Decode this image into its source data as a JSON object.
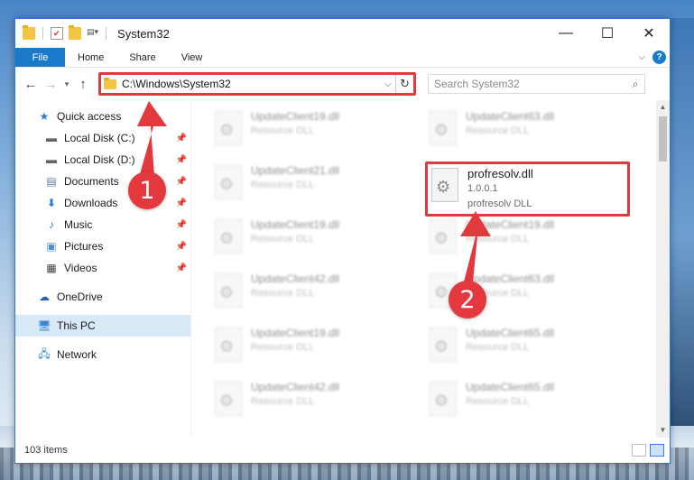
{
  "window": {
    "title": "System32",
    "controls": {
      "minimize": "—",
      "maximize": "☐",
      "close": "✕"
    }
  },
  "ribbon": {
    "tabs": [
      {
        "label": "File"
      },
      {
        "label": "Home"
      },
      {
        "label": "Share"
      },
      {
        "label": "View"
      }
    ],
    "help": "?"
  },
  "addressbar": {
    "path": "C:\\Windows\\System32",
    "search_placeholder": "Search System32"
  },
  "navpane": {
    "items": [
      {
        "label": "Quick access",
        "icon": "star-icon"
      },
      {
        "label": "Local Disk (C:)",
        "icon": "drive-icon",
        "pinned": true
      },
      {
        "label": "Local Disk (D:)",
        "icon": "drive-icon",
        "pinned": true
      },
      {
        "label": "Documents",
        "icon": "documents-icon",
        "pinned": true
      },
      {
        "label": "Downloads",
        "icon": "download-icon",
        "pinned": true
      },
      {
        "label": "Music",
        "icon": "music-icon",
        "pinned": true
      },
      {
        "label": "Pictures",
        "icon": "pictures-icon",
        "pinned": true
      },
      {
        "label": "Videos",
        "icon": "videos-icon",
        "pinned": true
      },
      {
        "label": "OneDrive",
        "icon": "cloud-icon"
      },
      {
        "label": "This PC",
        "icon": "computer-icon",
        "selected": true
      },
      {
        "label": "Network",
        "icon": "network-icon"
      }
    ]
  },
  "files": {
    "left_column": [
      {
        "name": "UpdateClient19.dll",
        "type": "Resource DLL"
      },
      {
        "name": "UpdateClient21.dll",
        "type": "Resource DLL"
      },
      {
        "name": "UpdateClient19.dll",
        "type": "Resource DLL"
      },
      {
        "name": "UpdateClient42.dll",
        "type": "Resource DLL"
      },
      {
        "name": "UpdateClient19.dll",
        "type": "Resource DLL"
      },
      {
        "name": "UpdateClient42.dll",
        "type": "Resource DLL"
      }
    ],
    "right_column": [
      {
        "name": "UpdateClient63.dll",
        "type": "Resource DLL"
      },
      {
        "name": "UpdateClient19.dll",
        "type": "Resource DLL"
      },
      {
        "name": "UpdateClient63.dll",
        "type": "Resource DLL"
      },
      {
        "name": "UpdateClient65.dll",
        "type": "Resource DLL"
      },
      {
        "name": "UpdateClient65.dll",
        "type": "Resource DLL"
      }
    ],
    "highlighted": {
      "name": "profresolv.dll",
      "version": "1.0.0.1",
      "description": "profresolv DLL"
    }
  },
  "statusbar": {
    "item_count": "103 items"
  },
  "annotations": {
    "badge_1": "1",
    "badge_2": "2",
    "color": "#e3393e"
  }
}
